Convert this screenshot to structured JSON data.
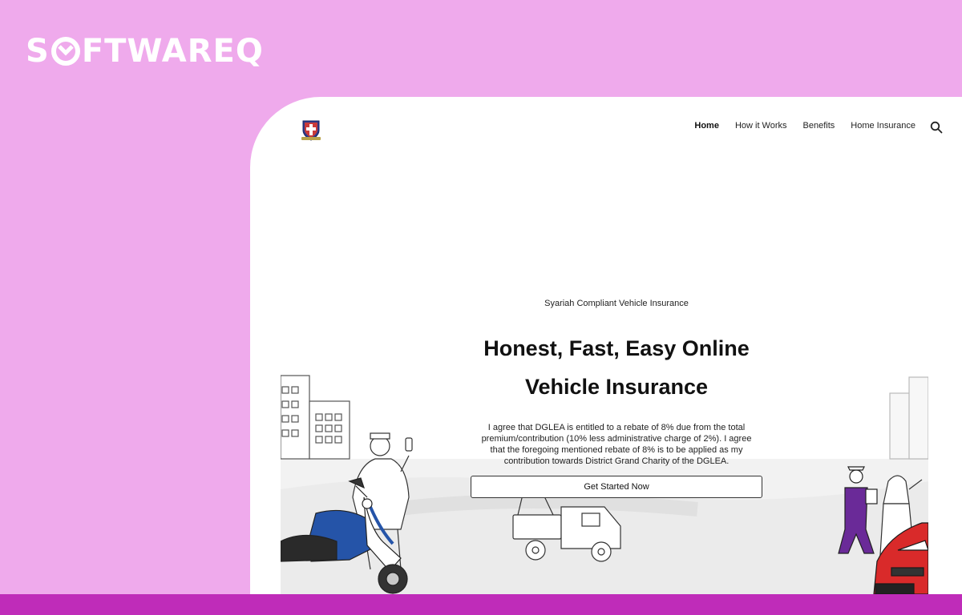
{
  "watermark": {
    "brand": "SOFTWAREQ"
  },
  "nav": {
    "items": [
      "Home",
      "How it Works",
      "Benefits",
      "Home Insurance"
    ],
    "active": "Home"
  },
  "hero": {
    "eyebrow": "Syariah Compliant Vehicle Insurance",
    "headline_line1": "Honest, Fast, Easy Online",
    "headline_line2": "Vehicle Insurance",
    "body": "I agree that DGLEA is entitled to a rebate of 8% due from the total premium/contribution (10% less administrative charge of 2%). I agree that the foregoing mentioned rebate of 8% is to be applied as my contribution towards District Grand Charity of the DGLEA.",
    "cta_label": "Get Started Now"
  },
  "icons": [
    "search-icon",
    "logo-crest-icon"
  ],
  "colors": {
    "background": "#efaaec",
    "bottom_bar": "#bf2cb9",
    "card": "#ffffff",
    "scooter_blue": "#2554a8",
    "car_red": "#d92a2a",
    "worker_purple": "#6a2a98"
  }
}
